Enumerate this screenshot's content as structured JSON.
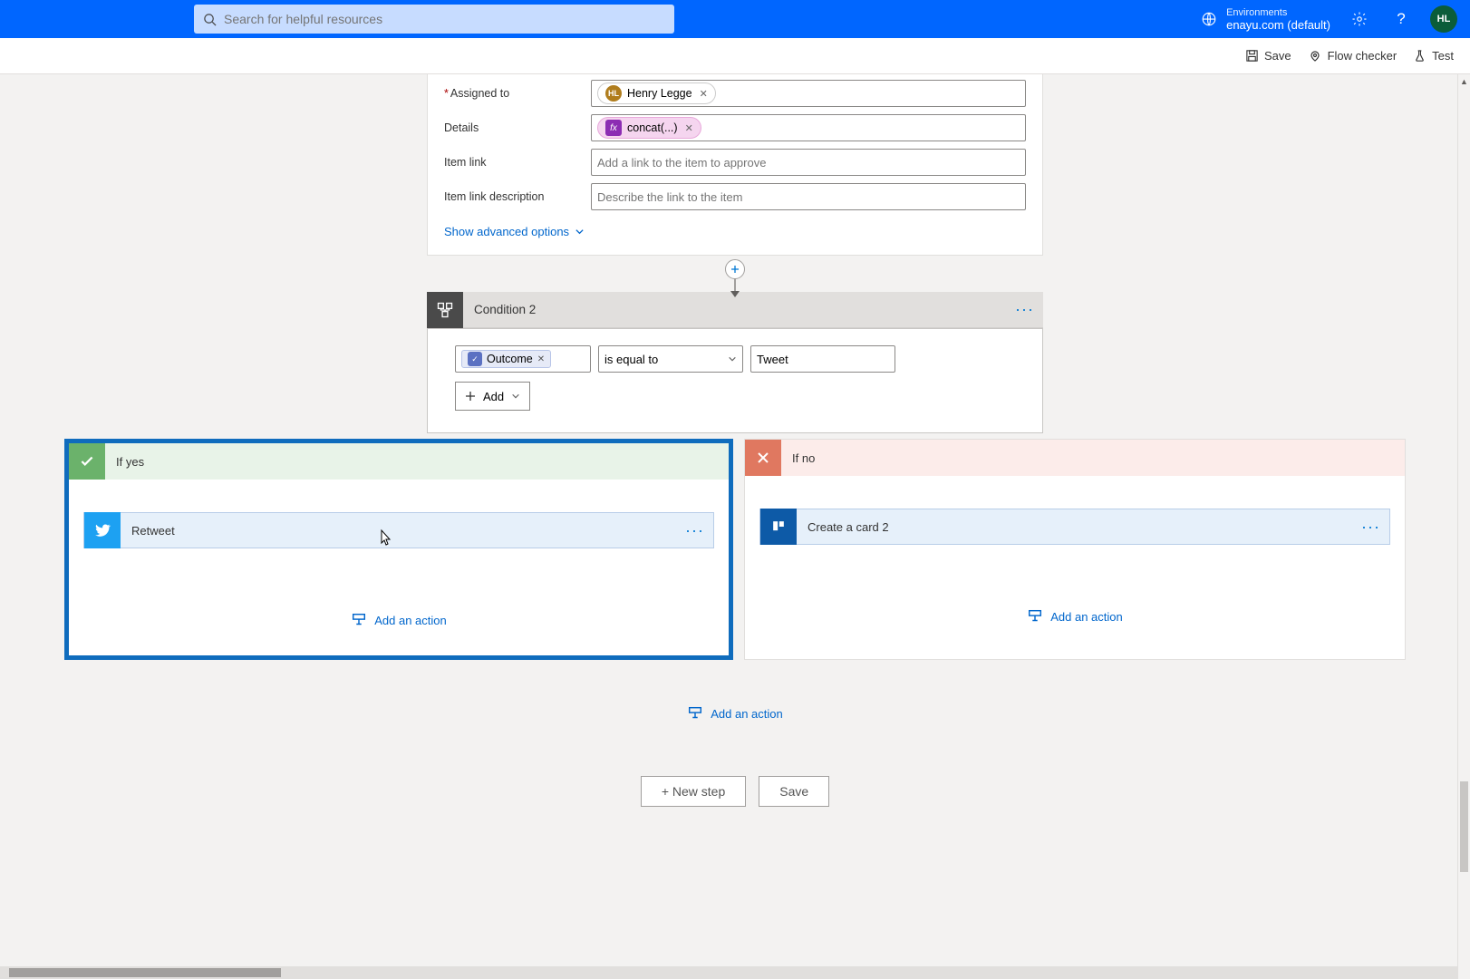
{
  "header": {
    "search_placeholder": "Search for helpful resources",
    "env_label": "Environments",
    "env_name": "enayu.com (default)",
    "avatar_initials": "HL"
  },
  "cmdbar": {
    "save": "Save",
    "flow_checker": "Flow checker",
    "test": "Test"
  },
  "approval": {
    "labels": {
      "assigned_to": "Assigned to",
      "details": "Details",
      "item_link": "Item link",
      "item_link_desc": "Item link description"
    },
    "assigned_user": "Henry Legge",
    "assigned_user_initials": "HL",
    "details_token": "concat(...)",
    "item_link_placeholder": "Add a link to the item to approve",
    "item_link_desc_placeholder": "Describe the link to the item",
    "show_advanced": "Show advanced options"
  },
  "condition": {
    "title": "Condition 2",
    "field_token": "Outcome",
    "operator": "is equal to",
    "value": "Tweet",
    "add_label": "Add"
  },
  "branches": {
    "yes": {
      "title": "If yes",
      "action_title": "Retweet",
      "add_action": "Add an action"
    },
    "no": {
      "title": "If no",
      "action_title": "Create a card 2",
      "add_action": "Add an action"
    },
    "add_action_bottom": "Add an action"
  },
  "footer": {
    "new_step": "+ New step",
    "save": "Save"
  }
}
